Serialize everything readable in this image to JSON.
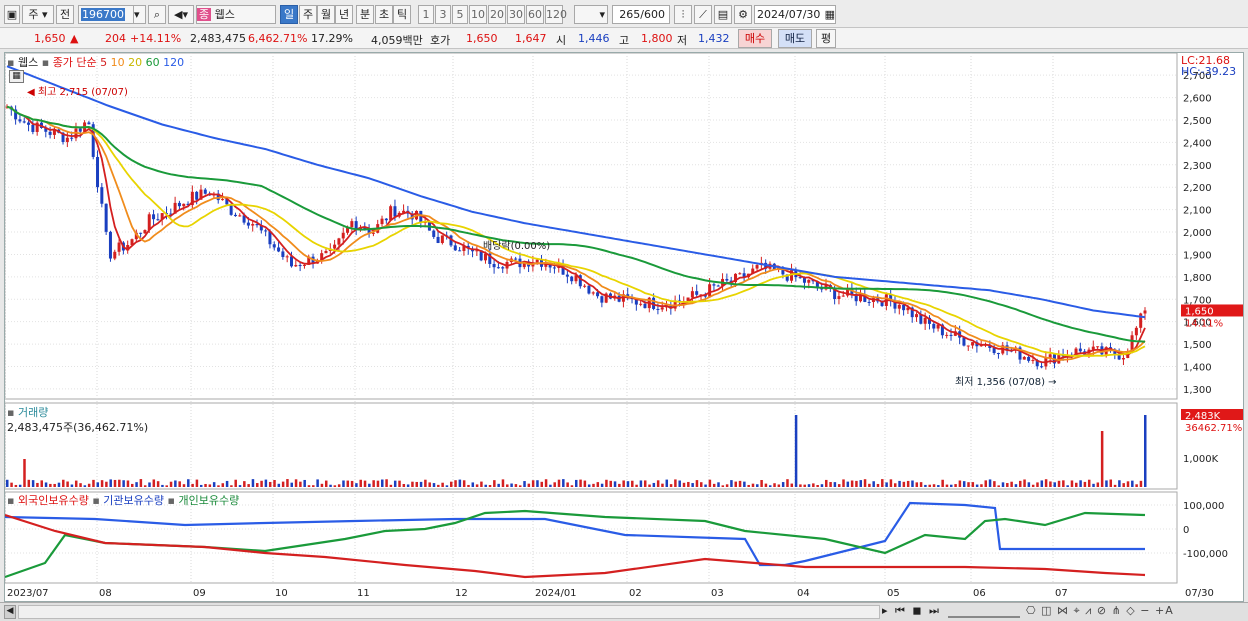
{
  "toolbar": {
    "period_label": "주",
    "prev_label": "전",
    "code_value": "196700",
    "brand_badge": "종",
    "stock_name": "웹스",
    "tabs": [
      "일",
      "주",
      "월",
      "년",
      "분",
      "초",
      "틱"
    ],
    "interval_buttons": [
      "1",
      "3",
      "5",
      "10",
      "20",
      "30",
      "60",
      "120"
    ],
    "count_value": "265",
    "count_total": "/600",
    "date_value": "2024/07/30"
  },
  "info": {
    "price": "1,650",
    "change_arrow": "▲",
    "change": "204",
    "change_pct": "+14.11%",
    "volume": "2,483,475",
    "volume_pct": "6,462.71%",
    "turnover_pct": "17.29%",
    "amount": "4,059백만",
    "quote_label": "호가",
    "ask": "1,650",
    "bid": "1,647",
    "open_label": "시",
    "open": "1,446",
    "high_label": "고",
    "high": "1,800",
    "low_label": "저",
    "low": "1,432",
    "buy_label": "매수",
    "sell_label": "매도",
    "avg_label": "평"
  },
  "price_panel": {
    "name": "웹스",
    "ma_label": "종가 단순",
    "ma_periods": [
      "5",
      "10",
      "20",
      "60",
      "120"
    ],
    "ma_colors": [
      "#d42020",
      "#f08c1c",
      "#e8d400",
      "#1a9a3a",
      "#2a5ce6"
    ],
    "lc": "LC:21.68",
    "hc": "HC:-39.23",
    "max_note": "최고 2,715 (07/07)",
    "min_note": "최저 1,356 (07/08)",
    "dividend_note": "배당락(0.00%)",
    "current_price_tag": "1,650",
    "current_pct_tag": "14.11%"
  },
  "volume_panel": {
    "name": "거래량",
    "value": "2,483,475주(36,462.71%)",
    "tag_value": "2,483K",
    "tag_pct": "36462.71%",
    "tick": "1,000K"
  },
  "holdings_panel": {
    "series": [
      "외국인보유수량",
      "기관보유수량",
      "개인보유수량"
    ],
    "ticks": [
      "100,000",
      "0",
      "-100,000"
    ]
  },
  "x_axis": [
    "2023/07",
    "08",
    "09",
    "10",
    "11",
    "12",
    "2024/01",
    "02",
    "03",
    "04",
    "05",
    "06",
    "07"
  ],
  "x_axis_right": "07/30",
  "chart_data": {
    "type": "line",
    "y_ticks": [
      2700,
      2600,
      2500,
      2400,
      2300,
      2200,
      2100,
      2000,
      1900,
      1800,
      1700,
      1600,
      1500,
      1400,
      1300
    ],
    "ylim": [
      1255,
      2790
    ],
    "close_series_approx": [
      2560,
      2480,
      2450,
      2420,
      2500,
      1900,
      1950,
      2050,
      2100,
      2150,
      2180,
      2100,
      2050,
      1950,
      1850,
      1880,
      1900,
      2050,
      2000,
      2100,
      2080,
      1980,
      1950,
      1900,
      1870,
      1860,
      1880,
      1850,
      1800,
      1720,
      1700,
      1690,
      1680,
      1690,
      1720,
      1760,
      1790,
      1840,
      1820,
      1790,
      1750,
      1720,
      1710,
      1700,
      1680,
      1600,
      1560,
      1520,
      1500,
      1480,
      1450,
      1420,
      1460,
      1470,
      1460,
      1455,
      1650
    ],
    "ma120_approx": [
      2740,
      2650,
      2560,
      2480,
      2420,
      2370,
      2300,
      2240,
      2160,
      2090,
      2040,
      2000,
      1960,
      1920,
      1880,
      1840,
      1800,
      1780,
      1760,
      1740,
      1700,
      1650,
      1620
    ]
  }
}
